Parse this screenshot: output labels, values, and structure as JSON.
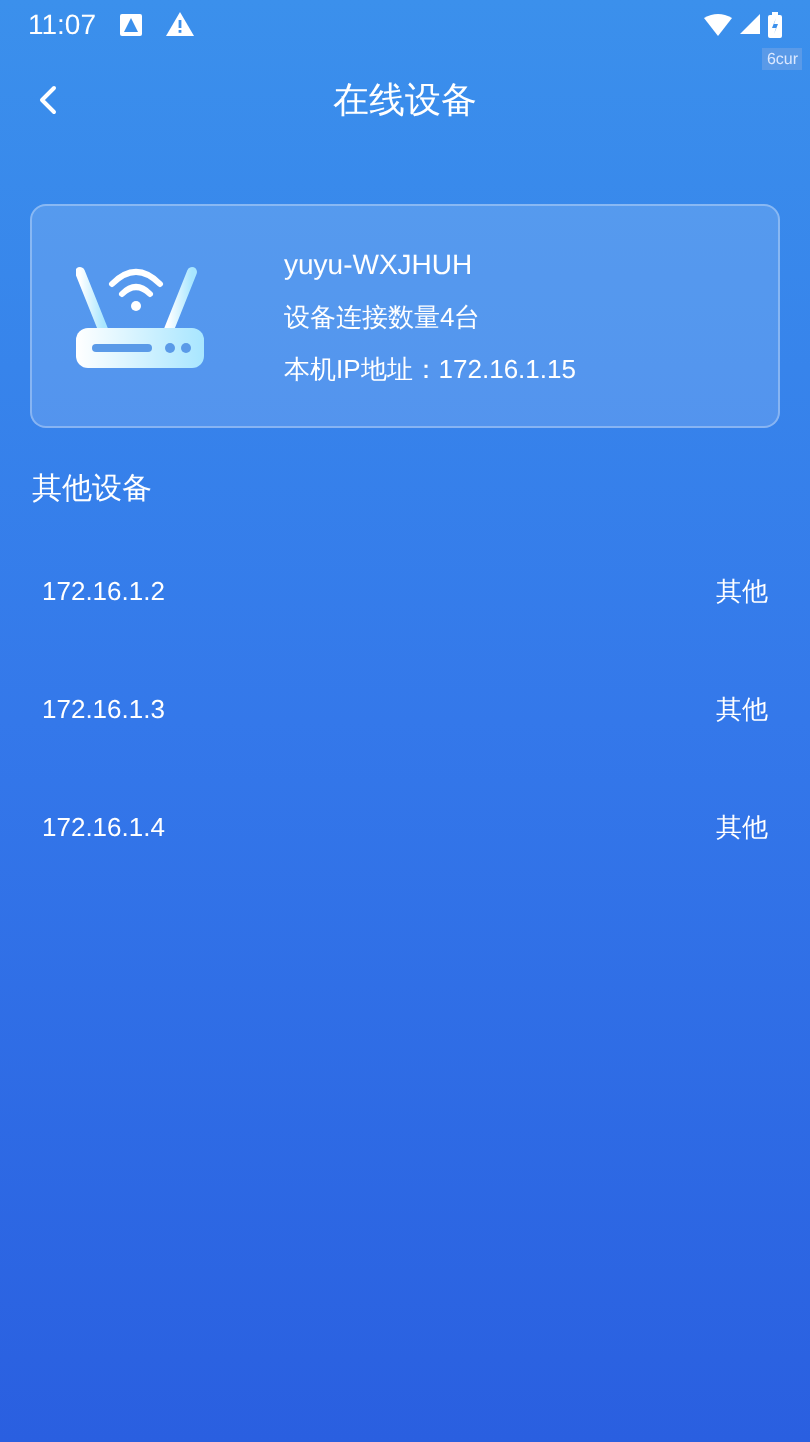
{
  "status_bar": {
    "time": "11:07",
    "badge": "6cur"
  },
  "header": {
    "title": "在线设备"
  },
  "router": {
    "name": "yuyu-WXJHUH",
    "count": "设备连接数量4台",
    "ip": "本机IP地址：172.16.1.15"
  },
  "section": {
    "title": "其他设备"
  },
  "devices": [
    {
      "ip": "172.16.1.2",
      "type": "其他"
    },
    {
      "ip": "172.16.1.3",
      "type": "其他"
    },
    {
      "ip": "172.16.1.4",
      "type": "其他"
    }
  ]
}
